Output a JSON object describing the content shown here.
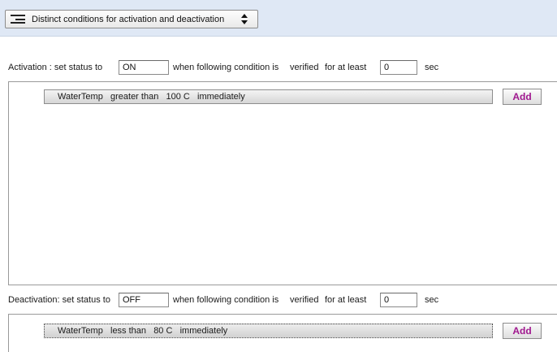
{
  "mode": {
    "label": "Distinct conditions for activation and deactivation",
    "icon": "lines-icon"
  },
  "activation": {
    "prefix": "Activation : set status to",
    "status_value": "ON",
    "middle": "when following condition is",
    "verified": "verified",
    "for_at_least": "for at least",
    "seconds_value": "0",
    "unit": "sec",
    "condition": "WaterTemp   greater than   100 C   immediately",
    "add_label": "Add"
  },
  "deactivation": {
    "prefix": "Deactivation: set status to",
    "status_value": "OFF",
    "middle": "when following condition is",
    "verified": "verified",
    "for_at_least": "for at least",
    "seconds_value": "0",
    "unit": "sec",
    "condition": "WaterTemp   less than   80 C   immediately",
    "add_label": "Add"
  },
  "colors": {
    "topbar": "#dfe8f5",
    "add_text": "#a0178f"
  }
}
